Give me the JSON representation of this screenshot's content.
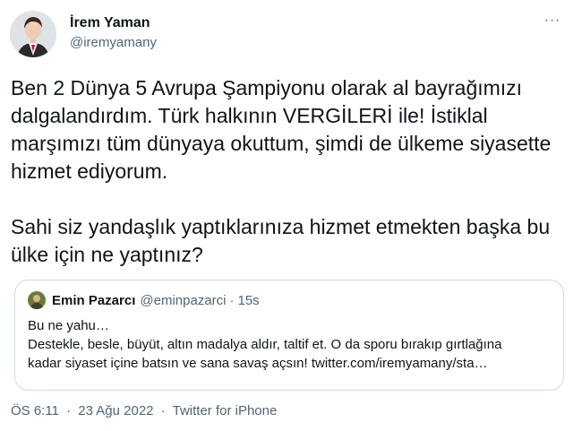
{
  "tweet": {
    "author_name": "İrem Yaman",
    "author_handle": "@iremyamany",
    "more_icon": "more-horizontal-icon",
    "paragraphs": [
      "Ben 2 Dünya 5 Avrupa Şampiyonu olarak al bayrağımızı dalgalandırdım. Türk halkının VERGİLERİ ile! İstiklal marşımızı tüm dünyaya okuttum, şimdi de ülkeme siyasette hizmet ediyorum.",
      "Sahi siz yandaşlık yaptıklarınıza hizmet etmekten başka bu ülke için ne yaptınız?"
    ],
    "quote": {
      "author_name": "Emin Pazarcı",
      "author_handle": "@eminpazarci",
      "separator": "·",
      "time": "15s",
      "lines": [
        "Bu ne yahu…",
        "Destekle, besle, büyüt, altın madalya aldır, taltif et. O da sporu bırakıp gırtlağına",
        "kadar siyaset içine batsın ve sana savaş açsın! twitter.com/iremyamany/sta…"
      ]
    },
    "footer": {
      "time": "ÖS 6:11",
      "date": "23 Ağu 2022",
      "source": "Twitter for iPhone",
      "separator": "·"
    }
  }
}
